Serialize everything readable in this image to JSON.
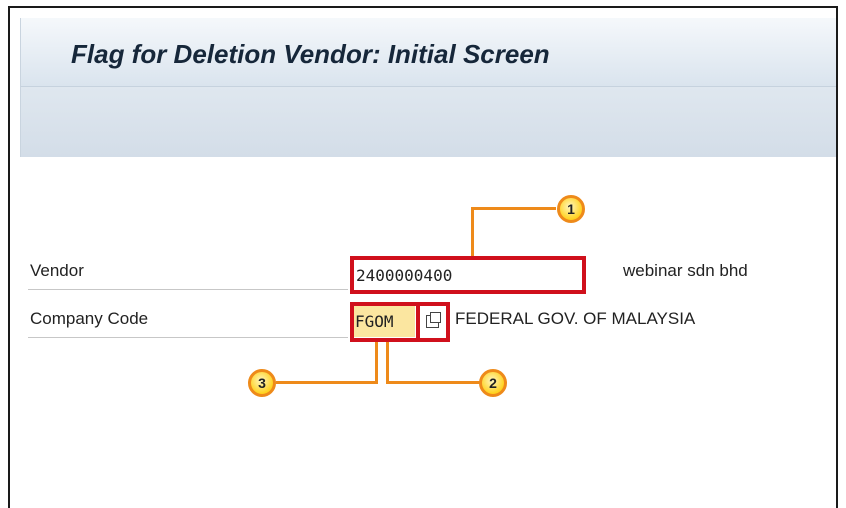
{
  "screen": {
    "title": "Flag for Deletion Vendor:  Initial Screen"
  },
  "fields": {
    "vendor": {
      "label": "Vendor",
      "value": "2400000400",
      "description": "webinar sdn bhd"
    },
    "company_code": {
      "label": "Company Code",
      "value": "FGOM",
      "description": "FEDERAL GOV. OF MALAYSIA"
    }
  },
  "callouts": [
    "1",
    "2",
    "3"
  ],
  "colors": {
    "highlight_red": "#d0101c",
    "callout_orange": "#ee8a1a",
    "callout_fill": "#ffd21f",
    "title_text": "#16273a"
  }
}
